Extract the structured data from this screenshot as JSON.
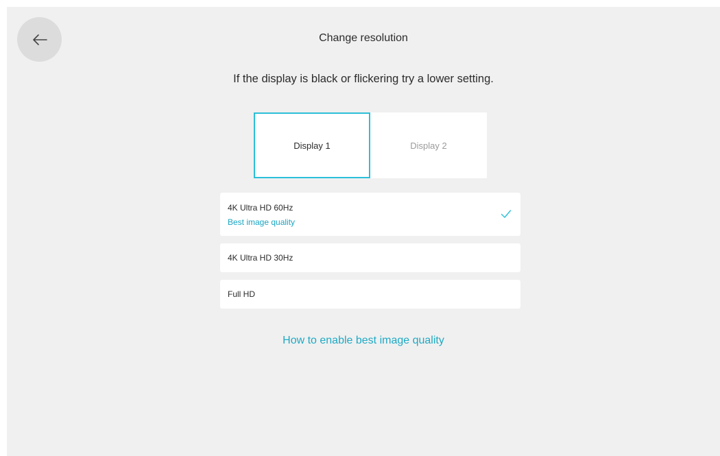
{
  "header": {
    "title": "Change resolution",
    "back_icon": "arrow-left-icon"
  },
  "instruction": "If the display is black or flickering try a lower setting.",
  "tabs": [
    {
      "label": "Display 1",
      "selected": true
    },
    {
      "label": "Display 2",
      "selected": false
    }
  ],
  "options": [
    {
      "label": "4K Ultra HD 60Hz",
      "sublabel": "Best image quality",
      "selected": true,
      "icon": "checkmark-icon"
    },
    {
      "label": "4K Ultra HD 30Hz",
      "selected": false
    },
    {
      "label": "Full HD",
      "selected": false
    }
  ],
  "help_link": "How to enable best image quality",
  "colors": {
    "accent": "#2bbfd8",
    "link": "#1ea9c4",
    "background": "#f0f0f0",
    "card": "#ffffff",
    "back_button": "#dcdcdc"
  }
}
